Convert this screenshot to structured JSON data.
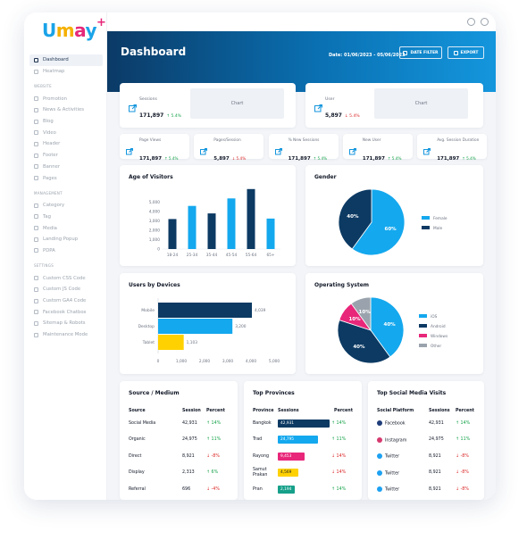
{
  "brand": {
    "logo_u": "U",
    "logo_m": "m",
    "logo_a": "a",
    "logo_y": "y",
    "logo_plus": "+"
  },
  "sidebar": {
    "primary": [
      {
        "label": "Dashboard",
        "icon": "dashboard-icon",
        "active": true
      },
      {
        "label": "Heatmap",
        "icon": "heatmap-icon"
      }
    ],
    "website_title": "WEBSITE",
    "website": [
      {
        "label": "Promotion",
        "icon": "promotion-icon"
      },
      {
        "label": "News & Activities",
        "icon": "news-icon"
      },
      {
        "label": "Blog",
        "icon": "blog-icon"
      },
      {
        "label": "Video",
        "icon": "video-icon"
      },
      {
        "label": "Header",
        "icon": "header-icon"
      },
      {
        "label": "Footer",
        "icon": "footer-icon"
      },
      {
        "label": "Banner",
        "icon": "banner-icon"
      },
      {
        "label": "Pages",
        "icon": "pages-icon"
      }
    ],
    "management_title": "MANAGEMENT",
    "management": [
      {
        "label": "Category",
        "icon": "category-icon"
      },
      {
        "label": "Tag",
        "icon": "tag-icon"
      },
      {
        "label": "Media",
        "icon": "media-icon"
      },
      {
        "label": "Landing Popup",
        "icon": "popup-icon"
      },
      {
        "label": "PDPA",
        "icon": "pdpa-icon"
      }
    ],
    "settings_title": "SETTINGS",
    "settings": [
      {
        "label": "Custom CSS Code",
        "icon": "css-icon"
      },
      {
        "label": "Custom JS Code",
        "icon": "js-icon"
      },
      {
        "label": "Custom GA4 Code",
        "icon": "ga4-icon"
      },
      {
        "label": "Facebook Chatbox",
        "icon": "facebook-icon"
      },
      {
        "label": "Sitemap & Robots",
        "icon": "sitemap-icon"
      },
      {
        "label": "Maintenance Mode",
        "icon": "maintenance-icon"
      }
    ]
  },
  "header": {
    "title": "Dashboard",
    "date": "Date: 01/06/2023 - 05/06/2023",
    "date_filter": "DATE FILTER",
    "export": "EXPORT"
  },
  "big_stats": [
    {
      "label": "Sessions",
      "value": "171,897",
      "pct": "5.4%",
      "dir": "up",
      "chart_label": "Chart"
    },
    {
      "label": "User",
      "value": "5,897",
      "pct": "5.4%",
      "dir": "down",
      "chart_label": "Chart"
    }
  ],
  "small_stats": [
    {
      "label": "Page Views",
      "value": "171,897",
      "pct": "5.4%",
      "dir": "up"
    },
    {
      "label": "Pages/Session",
      "value": "5,897",
      "pct": "5.4%",
      "dir": "down"
    },
    {
      "label": "% New Sessions",
      "value": "171,897",
      "pct": "5.4%",
      "dir": "up"
    },
    {
      "label": "New User",
      "value": "171,897",
      "pct": "5.4%",
      "dir": "up"
    },
    {
      "label": "Avg. Session Duration",
      "value": "171,897",
      "pct": "5.4%",
      "dir": "up"
    }
  ],
  "colors": {
    "navy": "#0c3a63",
    "sky": "#14a8ee",
    "yellow": "#ffd100",
    "pink": "#e8277a",
    "gray": "#9aa3ad",
    "green": "#16a34a",
    "red": "#dc2626"
  },
  "chart_data": [
    {
      "type": "bar",
      "title": "Age of Visitors",
      "categories": [
        "18-24",
        "25-34",
        "35-44",
        "45-54",
        "55-64",
        "65+"
      ],
      "series": [
        {
          "values": [
            3200,
            4600,
            3800,
            5400,
            6400,
            3250
          ]
        }
      ],
      "ylim": [
        0,
        6000
      ],
      "yticks": [
        0,
        1000,
        2000,
        3000,
        4000,
        5000
      ],
      "colors": [
        "#0c3a63",
        "#14a8ee",
        "#0c3a63",
        "#14a8ee",
        "#0c3a63",
        "#14a8ee"
      ]
    },
    {
      "type": "pie",
      "title": "Gender",
      "labels": [
        "Female",
        "Male"
      ],
      "values": [
        60,
        40
      ],
      "value_labels": [
        "60%",
        "40%"
      ],
      "colors": [
        "#14a8ee",
        "#0c3a63"
      ],
      "legend": "right"
    },
    {
      "type": "bar",
      "orientation": "horizontal",
      "title": "Users by Devices",
      "categories": [
        "Mobile",
        "Desktop",
        "Tablet"
      ],
      "values": [
        4039,
        3200,
        1103
      ],
      "value_labels": [
        "4,039",
        "3,200",
        "1,103"
      ],
      "xlim": [
        0,
        5000
      ],
      "xticks": [
        "0",
        "1,000",
        "2,000",
        "3,000",
        "4,000",
        "5,000"
      ],
      "colors": [
        "#0c3a63",
        "#14a8ee",
        "#ffd100"
      ]
    },
    {
      "type": "pie",
      "title": "Operating System",
      "labels": [
        "iOS",
        "Android",
        "Windows",
        "Other"
      ],
      "values": [
        40,
        40,
        10,
        10
      ],
      "value_labels": [
        "40%",
        "40%",
        "10%",
        "10%"
      ],
      "colors": [
        "#14a8ee",
        "#0c3a63",
        "#e8277a",
        "#9aa3ad"
      ],
      "legend": "right"
    }
  ],
  "source_medium": {
    "title": "Source / Medium",
    "headers": [
      "Source",
      "Session",
      "Percent"
    ],
    "rows": [
      {
        "source": "Social Media",
        "session": "42,931",
        "pct": "14%",
        "dir": "up"
      },
      {
        "source": "Organic",
        "session": "24,975",
        "pct": "11%",
        "dir": "up"
      },
      {
        "source": "Direct",
        "session": "8,921",
        "pct": "-8%",
        "dir": "down"
      },
      {
        "source": "Display",
        "session": "2,313",
        "pct": "6%",
        "dir": "up"
      },
      {
        "source": "Referral",
        "session": "696",
        "pct": "-4%",
        "dir": "down"
      }
    ]
  },
  "provinces": {
    "title": "Top Provinces",
    "headers": [
      "Province",
      "Sessions",
      "Percent"
    ],
    "rows": [
      {
        "name": "Bangkok",
        "value": "42,931",
        "share": 1.0,
        "color": "#0c3a63",
        "pct": "14%",
        "dir": "up"
      },
      {
        "name": "Trad",
        "value": "24,795",
        "share": 0.78,
        "color": "#14a8ee",
        "pct": "11%",
        "dir": "up"
      },
      {
        "name": "Rayong",
        "value": "9,453",
        "share": 0.52,
        "color": "#e8277a",
        "pct": "14%",
        "dir": "down"
      },
      {
        "name": "Samut Prakan",
        "value": "4,569",
        "share": 0.39,
        "color": "#ffd100",
        "pct": "14%",
        "dir": "down"
      },
      {
        "name": "Pran",
        "value": "2,194",
        "share": 0.33,
        "color": "#16a08a",
        "pct": "14%",
        "dir": "up"
      }
    ]
  },
  "social": {
    "title": "Top Social Media Visits",
    "headers": [
      "Social Platform",
      "Sessions",
      "Percent"
    ],
    "rows": [
      {
        "name": "Facebook",
        "session": "42,931",
        "pct": "14%",
        "dir": "up",
        "icon": "facebook-icon",
        "color": "#1f3d7a"
      },
      {
        "name": "Instagram",
        "session": "24,975",
        "pct": "11%",
        "dir": "up",
        "icon": "instagram-icon",
        "color": "#d63a6e"
      },
      {
        "name": "Twitter",
        "session": "8,921",
        "pct": "-8%",
        "dir": "down",
        "icon": "twitter-icon",
        "color": "#1da1f2"
      },
      {
        "name": "Twitter",
        "session": "8,921",
        "pct": "-8%",
        "dir": "down",
        "icon": "twitter-icon",
        "color": "#1da1f2"
      },
      {
        "name": "Twitter",
        "session": "8,921",
        "pct": "-8%",
        "dir": "down",
        "icon": "twitter-icon",
        "color": "#1da1f2"
      }
    ]
  }
}
